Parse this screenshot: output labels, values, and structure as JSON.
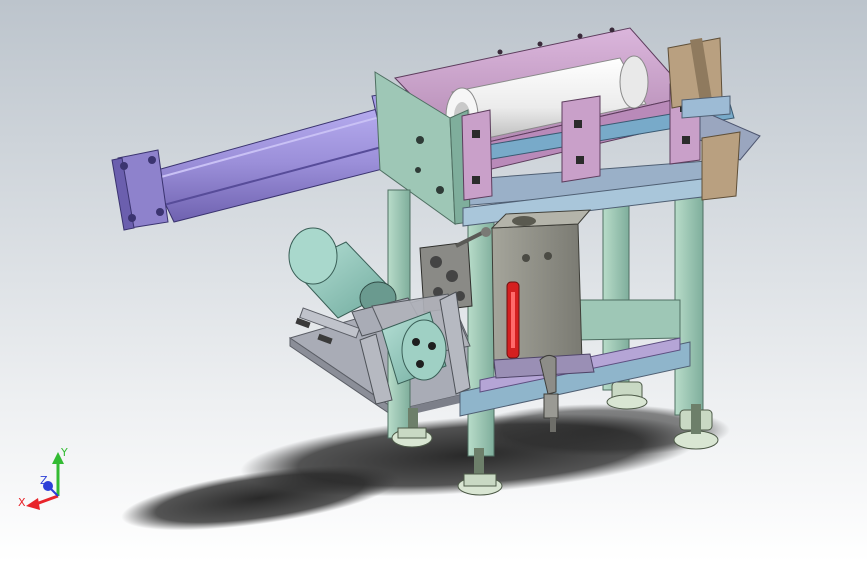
{
  "viewport": {
    "background_top": "#bcc4cc",
    "background_bottom": "#ffffff"
  },
  "triad": {
    "x_label": "X",
    "y_label": "Y",
    "z_label": "Z",
    "x_color": "#e8242a",
    "y_color": "#33bb33",
    "z_color": "#2d3fd8"
  },
  "colors": {
    "cylinder_purple": "#9b8fd9",
    "frame_green": "#9ec7b6",
    "housing_pink": "#c9a0c9",
    "block_tan": "#b9a080",
    "pump_teal": "#8fc9bc",
    "tank_gray": "#8f8f86",
    "sight_glass_red": "#d42020",
    "shaft_blue": "#78aac9",
    "roller_white": "#f4f4f4",
    "base_plate_gray": "#a9acb6"
  }
}
